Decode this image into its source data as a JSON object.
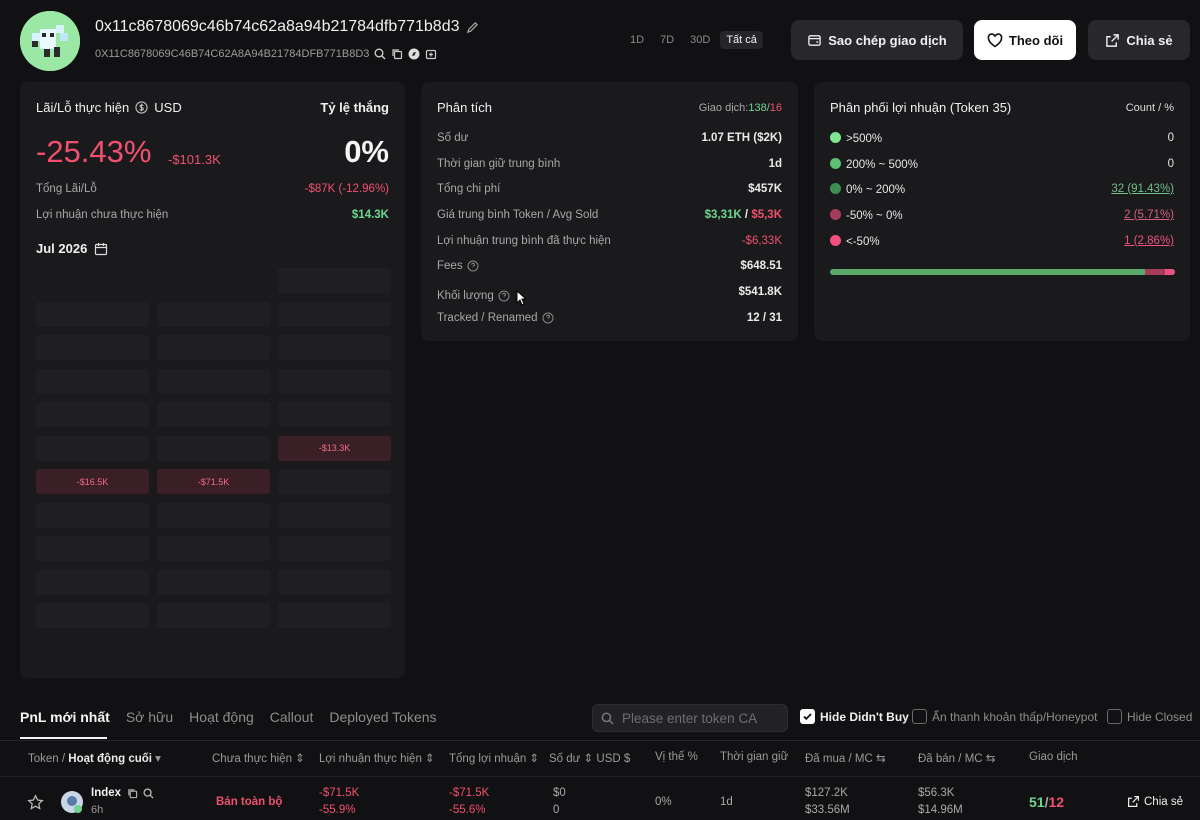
{
  "header": {
    "address": "0x11c8678069c46b74c62a8a94b21784dfb771b8d3",
    "address_upper": "0X11C8678069C46B74C62A8A94B21784DFB771B8D3",
    "ranges": [
      "1D",
      "7D",
      "30D",
      "Tất cả"
    ],
    "active_range": "Tất cả",
    "copy_trade_label": "Sao chép giao dịch",
    "follow_label": "Theo dõi",
    "share_label": "Chia sẻ"
  },
  "pnl_card": {
    "title": "Lãi/Lỗ thực hiện",
    "currency": "USD",
    "win_rate_label": "Tỷ lệ thắng",
    "pnl_percent": "-25.43%",
    "pnl_value": "-$101.3K",
    "win_rate": "0%",
    "total_label": "Tổng Lãi/Lỗ",
    "total_value": "-$87K (-12.96%)",
    "unrealized_label": "Lợi nhuận chưa thực hiện",
    "unrealized_value": "$14.3K",
    "month": "Jul 2026",
    "calendar": [
      {
        "row": 0,
        "col": 2,
        "value": ""
      },
      {
        "row": 1,
        "col": 0,
        "value": ""
      },
      {
        "row": 1,
        "col": 1,
        "value": ""
      },
      {
        "row": 1,
        "col": 2,
        "value": ""
      },
      {
        "row": 2,
        "col": 0,
        "value": ""
      },
      {
        "row": 2,
        "col": 1,
        "value": ""
      },
      {
        "row": 2,
        "col": 2,
        "value": ""
      },
      {
        "row": 3,
        "col": 0,
        "value": ""
      },
      {
        "row": 3,
        "col": 1,
        "value": ""
      },
      {
        "row": 3,
        "col": 2,
        "value": ""
      },
      {
        "row": 4,
        "col": 0,
        "value": ""
      },
      {
        "row": 4,
        "col": 1,
        "value": ""
      },
      {
        "row": 4,
        "col": 2,
        "value": ""
      },
      {
        "row": 5,
        "col": 0,
        "value": ""
      },
      {
        "row": 5,
        "col": 1,
        "value": ""
      },
      {
        "row": 5,
        "col": 2,
        "value": "-$13.3K"
      },
      {
        "row": 6,
        "col": 0,
        "value": "-$16.5K"
      },
      {
        "row": 6,
        "col": 1,
        "value": "-$71.5K"
      },
      {
        "row": 6,
        "col": 2,
        "value": ""
      },
      {
        "row": 7,
        "col": 0,
        "value": ""
      },
      {
        "row": 7,
        "col": 1,
        "value": ""
      },
      {
        "row": 7,
        "col": 2,
        "value": ""
      },
      {
        "row": 8,
        "col": 0,
        "value": ""
      },
      {
        "row": 8,
        "col": 1,
        "value": ""
      },
      {
        "row": 8,
        "col": 2,
        "value": ""
      },
      {
        "row": 9,
        "col": 0,
        "value": ""
      },
      {
        "row": 9,
        "col": 1,
        "value": ""
      },
      {
        "row": 9,
        "col": 2,
        "value": ""
      },
      {
        "row": 10,
        "col": 0,
        "value": ""
      },
      {
        "row": 10,
        "col": 1,
        "value": ""
      },
      {
        "row": 10,
        "col": 2,
        "value": ""
      }
    ]
  },
  "analysis": {
    "title": "Phân tích",
    "tx_label": "Giao dịch:",
    "tx_wins": "138",
    "tx_losses": "16",
    "balance_label": "Số dư",
    "balance_value": "1.07 ETH ($2K)",
    "hold_label": "Thời gian giữ trung bình",
    "hold_value": "1d",
    "cost_label": "Tổng chi phí",
    "cost_value": "$457K",
    "avg_label": "Giá trung bình Token / Avg Sold",
    "avg_buy": "$3,31K",
    "avg_sold": "$5,3K",
    "avg_realized_label": "Lợi nhuận trung bình đã thực hiện",
    "avg_realized_value": "-$6,33K",
    "fees_label": "Fees",
    "fees_value": "$648.51",
    "volume_label": "Khối lượng",
    "volume_value": "$541.8K",
    "tracked_label": "Tracked / Renamed",
    "tracked_value": "12 / 31"
  },
  "distribution": {
    "title": "Phân phối lợi nhuận (Token 35)",
    "count_label": "Count / %",
    "buckets": [
      {
        "label": ">500%",
        "value": "0",
        "color": "#7ee68e"
      },
      {
        "label": "200% ~ 500%",
        "value": "0",
        "color": "#5fbf74"
      },
      {
        "label": "0% ~ 200%",
        "value": "32 (91.43%)",
        "color": "#3f8f55"
      },
      {
        "label": "-50% ~ 0%",
        "value": "2 (5.71%)",
        "color": "#a33d5a"
      },
      {
        "label": "<-50%",
        "value": "1 (2.86%)",
        "color": "#f0507e"
      }
    ],
    "bar_fractions": [
      0.9143,
      0.0571,
      0.0286
    ]
  },
  "tabs": [
    "PnL mới nhất",
    "Sở hữu",
    "Hoạt động",
    "Callout",
    "Deployed Tokens"
  ],
  "search_placeholder": "Please enter token CA",
  "filters": {
    "hide_didnt_buy": "Hide Didn't Buy",
    "hide_low_liq": "Ẩn thanh khoản thấp/Honeypot",
    "hide_closed": "Hide Closed"
  },
  "table": {
    "headers": {
      "token": "Token",
      "last_active": "Hoạt động cuối",
      "unrealized": "Chưa thực hiện",
      "realized": "Lợi nhuận thực hiện",
      "total": "Tổng lợi nhuận",
      "balance": "Số dư",
      "usd": "USD",
      "position": "Vị thế %",
      "hold": "Thời gian giữ",
      "bought": "Đã mua",
      "bought_mc": "MC",
      "sold": "Đã bán",
      "sold_mc": "MC",
      "trades": "Giao dịch"
    },
    "rows": [
      {
        "name": "Index",
        "age": "6h",
        "unrealized": "Bán toàn bộ",
        "realized": "-$71.5K",
        "realized_pct": "-55.9%",
        "total": "-$71.5K",
        "total_pct": "-55.6%",
        "balance": "$0",
        "balance_amt": "0",
        "position": "0%",
        "hold": "1d",
        "bought": "$127.2K",
        "bought_mc": "$33.56M",
        "sold": "$56.3K",
        "sold_mc": "$14.96M",
        "buys": "51",
        "sells": "12",
        "share": "Chia sẻ"
      }
    ]
  }
}
